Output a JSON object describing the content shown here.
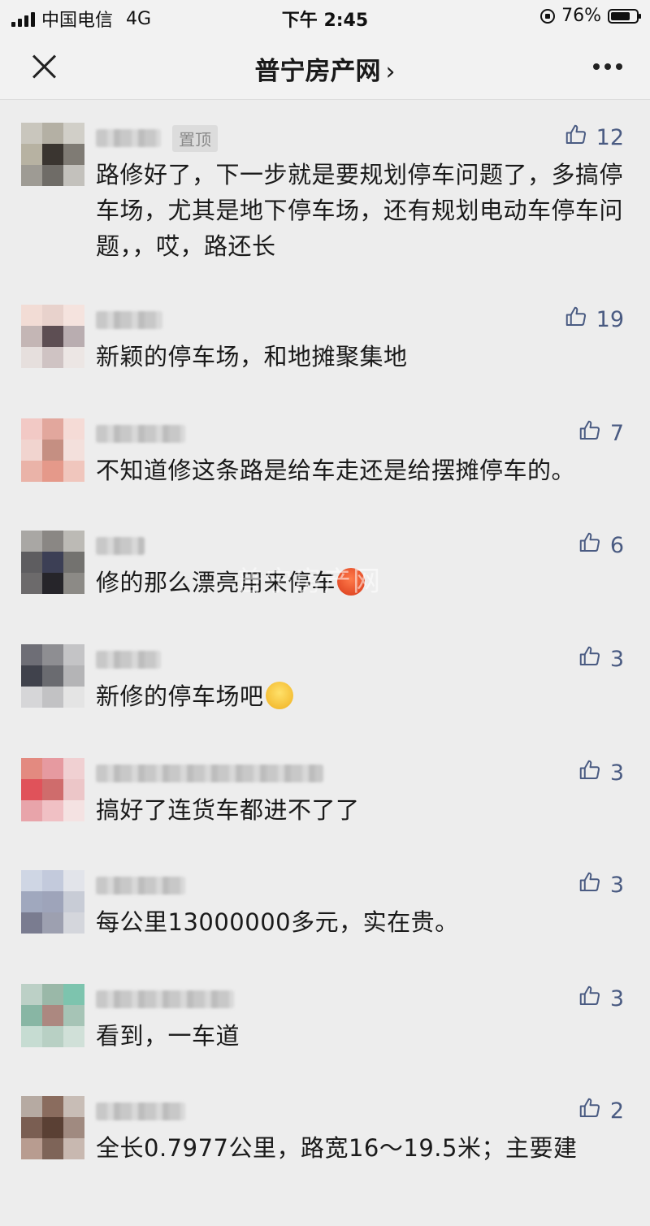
{
  "status_bar": {
    "carrier": "中国电信",
    "network": "4G",
    "time": "下午 2:45",
    "battery": "76%",
    "battery_level": 0.76
  },
  "nav": {
    "title": "普宁房产网",
    "chevron": "›"
  },
  "comments": [
    {
      "pinned_label": "置顶",
      "likes": "12",
      "text": "路修好了，下一步就是要规划停车问题了，多搞停车场，尤其是地下停车场，还有规划电动车停车问题，，哎，路还长",
      "colors": [
        "#c9c6bd",
        "#b4b0a4",
        "#d1cfc8",
        "#b7b2a2",
        "#3a3530",
        "#7f7b74",
        "#9e9b94",
        "#6f6c67",
        "#c3c1bc"
      ]
    },
    {
      "likes": "19",
      "text": "新颖的停车场，和地摊聚集地",
      "colors": [
        "#f2dcd5",
        "#e8d2cc",
        "#f5e3de",
        "#c4b6b5",
        "#5d4e53",
        "#b9adb0",
        "#e6dfdd",
        "#cfc3c3",
        "#ece6e4"
      ]
    },
    {
      "likes": "7",
      "text": "不知道修这条路是给车走还是给摆摊停车的。",
      "colors": [
        "#f2c9c5",
        "#e2a79d",
        "#f5dbd6",
        "#f1d4cf",
        "#c58f82",
        "#f3e0dc",
        "#eab3a8",
        "#e5998a",
        "#f0c6bd"
      ]
    },
    {
      "likes": "6",
      "text": "修的那么漂亮用来停车",
      "emoji": "angry",
      "colors": [
        "#a9a7a4",
        "#8a8784",
        "#bcbab5",
        "#5e5d60",
        "#3c3f55",
        "#73726f",
        "#6c6a6b",
        "#26252a",
        "#8c8a86"
      ]
    },
    {
      "likes": "3",
      "text": "新修的停车场吧",
      "emoji": "think",
      "colors": [
        "#6e6e76",
        "#8e8e92",
        "#c4c4c6",
        "#40424c",
        "#6a6b70",
        "#b4b4b6",
        "#d6d6d8",
        "#c2c2c4",
        "#e4e4e4"
      ]
    },
    {
      "likes": "3",
      "text": "搞好了连货车都进不了了",
      "colors": [
        "#e38a80",
        "#e69aa0",
        "#f0d0d2",
        "#e0525a",
        "#cf6c6c",
        "#ecc6c8",
        "#e8a4aa",
        "#f0c0c4",
        "#f4e2e2"
      ]
    },
    {
      "likes": "3",
      "text": "每公里13000000多元，实在贵。",
      "colors": [
        "#cfd6e4",
        "#c3cadc",
        "#e2e4ea",
        "#a0a8be",
        "#9ea4ba",
        "#c8ccd6",
        "#7a7c90",
        "#9da0b0",
        "#d4d6dc"
      ]
    },
    {
      "likes": "3",
      "text": "看到，一车道",
      "colors": [
        "#bcd0c6",
        "#9ab8a8",
        "#7dc4ae",
        "#88b6a4",
        "#ac8880",
        "#a6c4b6",
        "#c6dcd2",
        "#b8d0c4",
        "#d0e0d8"
      ]
    },
    {
      "likes": "2",
      "text": "全长0.7977公里，路宽16～19.5米；主要建",
      "colors": [
        "#b6aaa2",
        "#8a6c5e",
        "#c8bdb6",
        "#7a5e52",
        "#5a4034",
        "#a08a80",
        "#b89c90",
        "#7e6458",
        "#c8b8b0"
      ]
    }
  ],
  "watermark": "普宁房产网"
}
